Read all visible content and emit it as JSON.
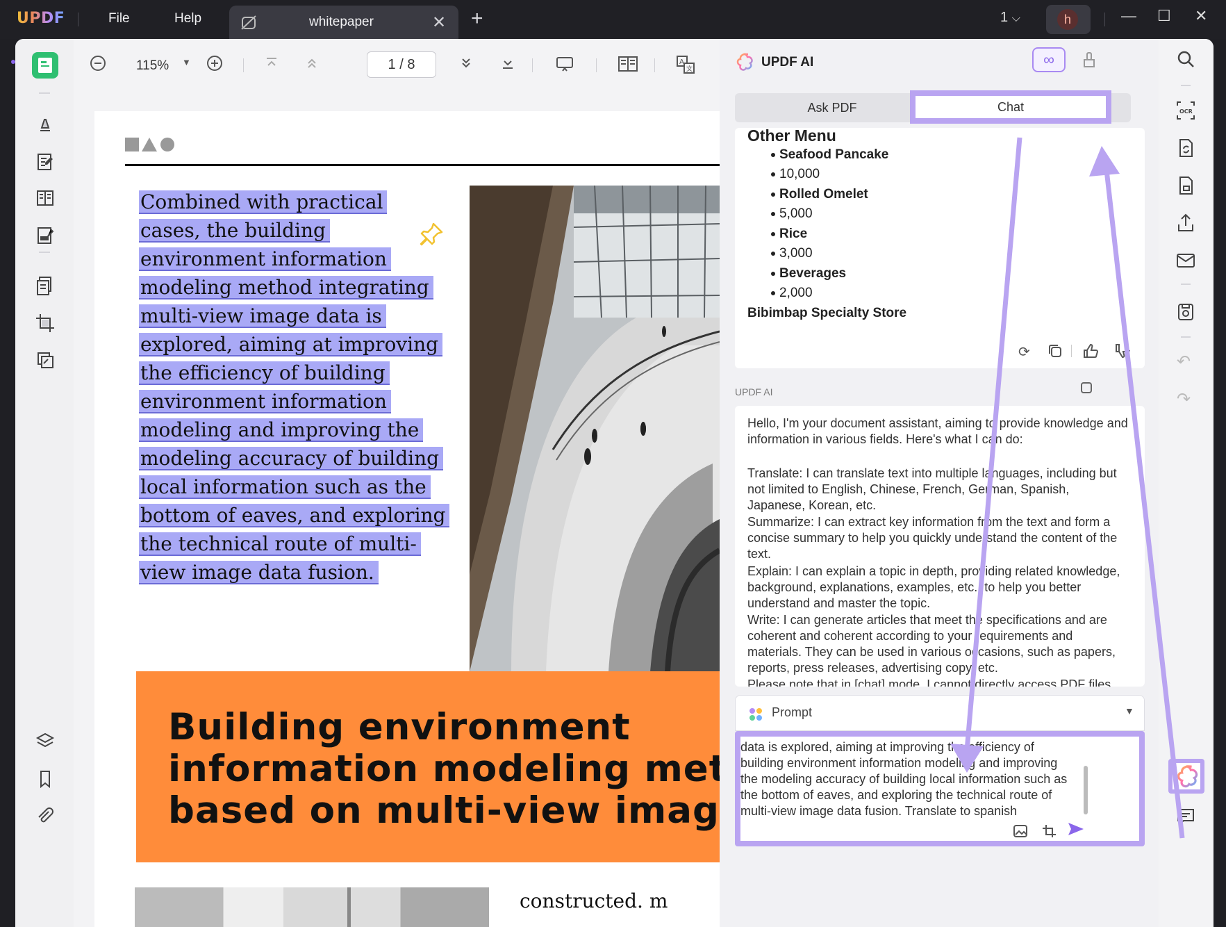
{
  "titlebar": {
    "logo": "UPDF",
    "menu_file": "File",
    "menu_help": "Help",
    "tab_title": "whitepaper",
    "tab_close": "✕",
    "new_tab": "+",
    "page_count": "1",
    "avatar_letter": "h"
  },
  "doc_toolbar": {
    "zoom": "115%",
    "page_indicator": "1 / 8"
  },
  "document": {
    "highlighted_lines": [
      "Combined with practical",
      "cases, the building",
      "environment information",
      "modeling method integrating",
      "multi-view image data is",
      "explored, aiming at improving",
      "the efficiency of building",
      "environment information",
      "modeling and improving the",
      "modeling accuracy of building",
      "local information such as the",
      "bottom of eaves, and exploring",
      "the technical route of multi-",
      "view image data fusion."
    ],
    "heading_lines": [
      "Building environment",
      "information modeling metho",
      "based on multi-view image"
    ],
    "footer_text": "constructed. m"
  },
  "ai_panel": {
    "title": "UPDF AI",
    "tab_ask": "Ask PDF",
    "tab_chat": "Chat",
    "menu_title": "Other Menu",
    "menu_items": [
      {
        "text": "Seafood Pancake",
        "bold": true
      },
      {
        "text": "10,000",
        "bold": false
      },
      {
        "text": "Rolled Omelet",
        "bold": true
      },
      {
        "text": "5,000",
        "bold": false
      },
      {
        "text": "Rice",
        "bold": true
      },
      {
        "text": "3,000",
        "bold": false
      },
      {
        "text": "Beverages",
        "bold": true
      },
      {
        "text": "2,000",
        "bold": false
      }
    ],
    "store_name": "Bibimbap Specialty Store",
    "section_label": "UPDF AI",
    "response_paragraphs": [
      "Hello, I'm your document assistant, aiming to provide knowledge and information in various fields. Here's what I can do:",
      "Translate: I can translate text into multiple languages, including but not limited to English, Chinese, French, German, Spanish, Japanese, Korean, etc.",
      "Summarize: I can extract key information from the text and form a concise summary to help you quickly understand the content of the text.",
      "Explain: I can explain a topic in depth, providing related knowledge, background, explanations, examples, etc., to help you better understand and master the topic.",
      "Write: I can generate articles that meet the specifications and are coherent and coherent according to your requirements and materials. They can be used in various occasions, such as papers, reports, press releases, advertising copy, etc.",
      "Please note that in [chat] mode, I cannot directly access PDF files"
    ],
    "prompt_label": "Prompt",
    "input_text": "data is explored, aiming at improving the efficiency of\nbuilding environment information modeling and improving\nthe modeling accuracy of building local information such as\nthe bottom of eaves, and exploring the technical route of\nmulti-view image data fusion. Translate to spanish"
  },
  "colors": {
    "accent_purple": "#b9a4f1",
    "highlight": "#a9a9f6",
    "orange_banner": "#ff8c3a",
    "active_tool": "#2fbf71"
  }
}
